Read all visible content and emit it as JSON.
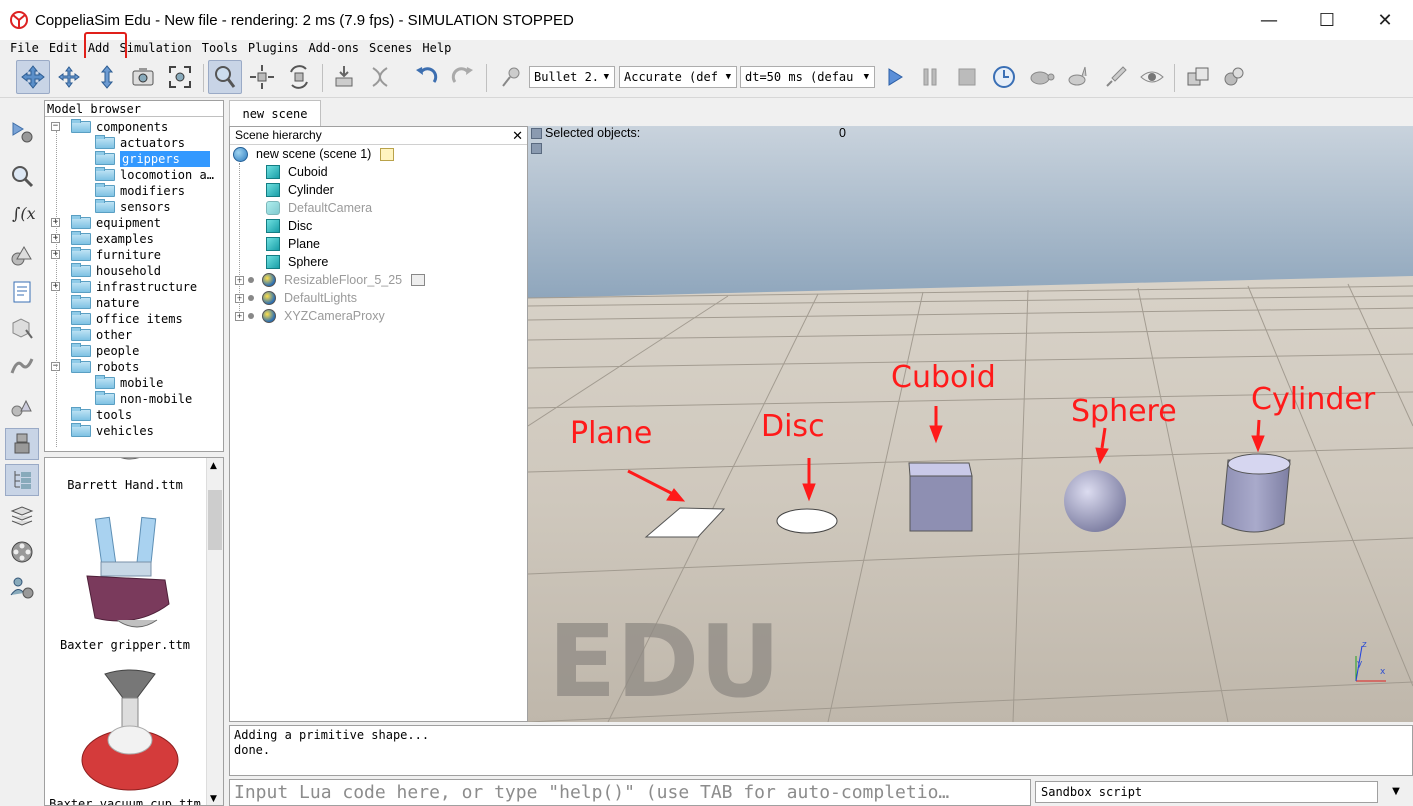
{
  "window": {
    "title": "CoppeliaSim Edu - New file - rendering: 2 ms (7.9 fps) - SIMULATION STOPPED",
    "minimize": "—",
    "maximize": "☐",
    "close": "✕"
  },
  "menu": [
    "File",
    "Edit",
    "Add",
    "Simulation",
    "Tools",
    "Plugins",
    "Add-ons",
    "Scenes",
    "Help"
  ],
  "toolbar": {
    "engine": "Bullet 2.",
    "accuracy": "Accurate (def",
    "timestep": "dt=50 ms (defau"
  },
  "model_browser": {
    "title": "Model browser",
    "items": [
      {
        "label": "components",
        "level": 0,
        "expander": "−"
      },
      {
        "label": "actuators",
        "level": 1
      },
      {
        "label": "grippers",
        "level": 1,
        "selected": true
      },
      {
        "label": "locomotion a…",
        "level": 1
      },
      {
        "label": "modifiers",
        "level": 1
      },
      {
        "label": "sensors",
        "level": 1
      },
      {
        "label": "equipment",
        "level": 0,
        "expander": "+"
      },
      {
        "label": "examples",
        "level": 0,
        "expander": "+"
      },
      {
        "label": "furniture",
        "level": 0,
        "expander": "+"
      },
      {
        "label": "household",
        "level": 0
      },
      {
        "label": "infrastructure",
        "level": 0,
        "expander": "+"
      },
      {
        "label": "nature",
        "level": 0
      },
      {
        "label": "office items",
        "level": 0
      },
      {
        "label": "other",
        "level": 0
      },
      {
        "label": "people",
        "level": 0
      },
      {
        "label": "robots",
        "level": 0,
        "expander": "−"
      },
      {
        "label": "mobile",
        "level": 1
      },
      {
        "label": "non-mobile",
        "level": 1
      },
      {
        "label": "tools",
        "level": 0
      },
      {
        "label": "vehicles",
        "level": 0
      }
    ]
  },
  "thumbnails": [
    "Barrett Hand.ttm",
    "Baxter gripper.ttm",
    "Baxter vacuum cup.ttm"
  ],
  "scene_tab": "new scene",
  "hierarchy": {
    "title": "Scene hierarchy",
    "root": "new scene (scene 1)",
    "items": [
      {
        "label": "Cuboid",
        "icon": "cube-icon",
        "dim": false
      },
      {
        "label": "Cylinder",
        "icon": "cube-icon",
        "dim": false
      },
      {
        "label": "DefaultCamera",
        "icon": "camera-icon",
        "dim": true
      },
      {
        "label": "Disc",
        "icon": "cube-icon",
        "dim": false
      },
      {
        "label": "Plane",
        "icon": "cube-icon",
        "dim": false
      },
      {
        "label": "Sphere",
        "icon": "cube-icon",
        "dim": false
      },
      {
        "label": "ResizableFloor_5_25",
        "icon": "dummy-icon",
        "dim": true,
        "expandable": true
      },
      {
        "label": "DefaultLights",
        "icon": "dummy-icon",
        "dim": true,
        "expandable": true
      },
      {
        "label": "XYZCameraProxy",
        "icon": "dummy-icon",
        "dim": true,
        "expandable": true
      }
    ]
  },
  "viewport": {
    "selected_label": "Selected objects:",
    "selected_count": "0",
    "watermark": "EDU",
    "annotations": [
      "Plane",
      "Disc",
      "Cuboid",
      "Sphere",
      "Cylinder"
    ],
    "axis_labels": [
      "z",
      "y",
      "x"
    ]
  },
  "console": {
    "lines": [
      "Adding a primitive shape...",
      "done."
    ]
  },
  "lua_input": {
    "placeholder": "Input Lua code here, or type \"help()\" (use TAB for auto-completio…"
  },
  "script_selector": "Sandbox script",
  "colors": {
    "annotation": "#ff1a1a",
    "selection": "#3399ff",
    "sky": "#8fa6bc"
  }
}
